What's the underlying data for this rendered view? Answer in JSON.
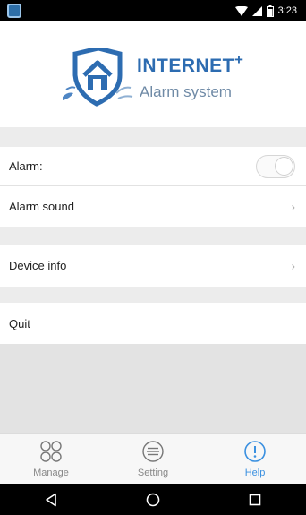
{
  "status_bar": {
    "time": "3:23",
    "icons": [
      "app-notification-icon",
      "wifi-icon",
      "signal-icon",
      "battery-icon"
    ]
  },
  "header": {
    "brand_title": "INTERNET",
    "brand_plus": "+",
    "brand_subtitle": "Alarm system",
    "logo_icon": "shield-house-logo"
  },
  "settings": {
    "alarm_label": "Alarm:",
    "alarm_enabled": false,
    "alarm_sound_label": "Alarm sound",
    "device_info_label": "Device info",
    "quit_label": "Quit",
    "chevron_glyph": "›"
  },
  "tabs": [
    {
      "label": "Manage",
      "icon": "grid-circles-icon",
      "active": false
    },
    {
      "label": "Setting",
      "icon": "list-circle-icon",
      "active": false
    },
    {
      "label": "Help",
      "icon": "exclamation-circle-icon",
      "active": true
    }
  ],
  "colors": {
    "brand_blue": "#2d6cb1",
    "active_tab": "#3a90e0",
    "inactive_tab": "#888888",
    "section_gap": "#ececec"
  },
  "nav_bar": {
    "icons": [
      "back-icon",
      "home-icon",
      "recents-icon"
    ]
  }
}
